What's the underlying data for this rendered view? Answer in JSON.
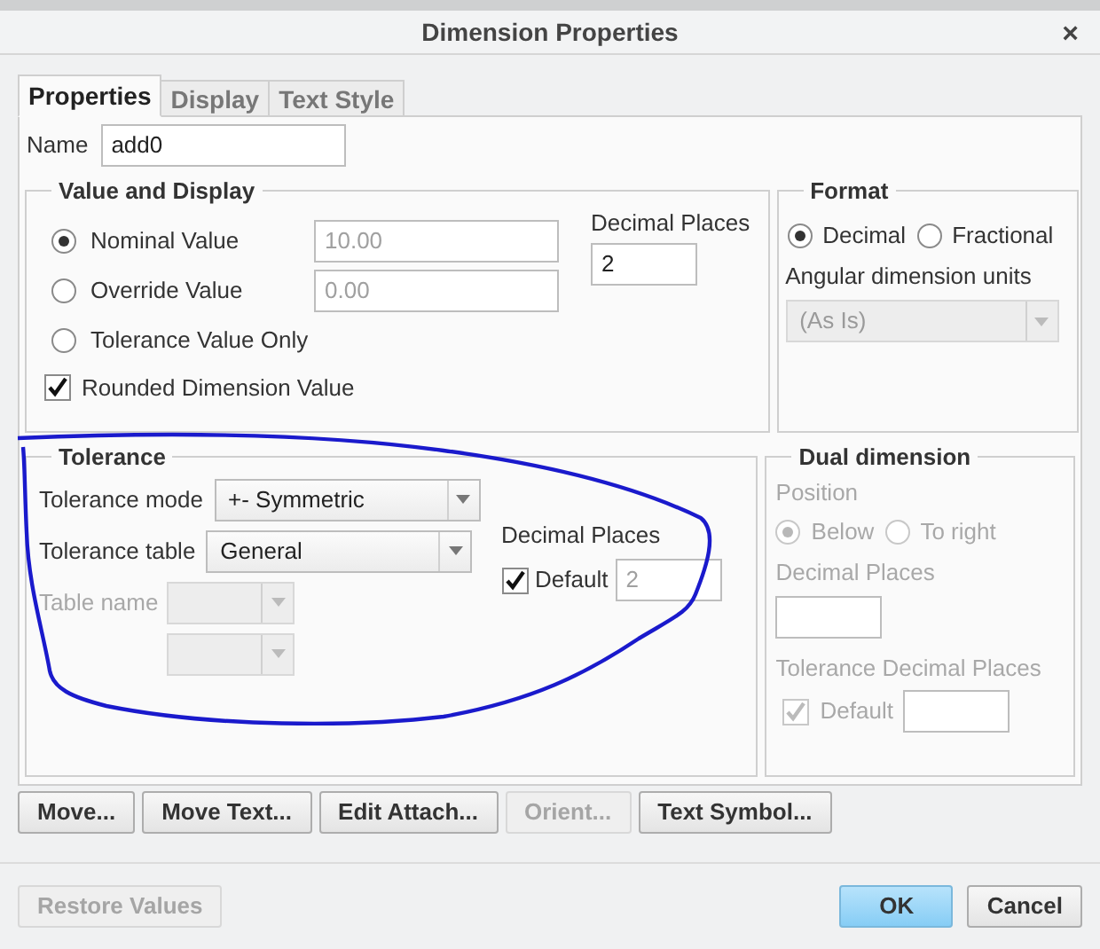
{
  "window": {
    "title": "Dimension Properties",
    "close": "×"
  },
  "tabs": [
    {
      "label": "Properties",
      "selected": true
    },
    {
      "label": "Display",
      "selected": false
    },
    {
      "label": "Text Style",
      "selected": false
    }
  ],
  "name": {
    "label": "Name",
    "value": "add0"
  },
  "value_and_display": {
    "title": "Value and Display",
    "options": [
      {
        "label": "Nominal Value",
        "selected": true,
        "field": {
          "value": "10.00",
          "disabled": true
        }
      },
      {
        "label": "Override Value",
        "selected": false,
        "field": {
          "value": "0.00",
          "disabled": true
        }
      },
      {
        "label": "Tolerance Value Only",
        "selected": false
      }
    ],
    "decimal_places": {
      "label": "Decimal Places",
      "value": "2"
    },
    "rounded": {
      "label": "Rounded Dimension Value",
      "checked": true
    }
  },
  "format": {
    "title": "Format",
    "options": [
      {
        "label": "Decimal",
        "selected": true
      },
      {
        "label": "Fractional",
        "selected": false
      }
    ],
    "angular_units": {
      "label": "Angular dimension units",
      "value": "(As Is)",
      "disabled": true
    }
  },
  "tolerance": {
    "title": "Tolerance",
    "mode": {
      "label": "Tolerance mode",
      "value": "+- Symmetric"
    },
    "table": {
      "label": "Tolerance table",
      "value": "General"
    },
    "table_name": {
      "label": "Table name",
      "disabled": true
    },
    "decimal_places": {
      "label": "Decimal Places",
      "default": {
        "label": "Default",
        "checked": true
      },
      "value": "2",
      "disabled": true
    }
  },
  "dual_dimension": {
    "title": "Dual dimension",
    "disabled": true,
    "position_label": "Position",
    "options": [
      {
        "label": "Below",
        "selected": true
      },
      {
        "label": "To right",
        "selected": false
      }
    ],
    "decimal_places_label": "Decimal Places",
    "tolerance_decimal_places_label": "Tolerance Decimal Places",
    "default": {
      "label": "Default",
      "checked": true
    }
  },
  "actions": [
    {
      "label": "Move...",
      "disabled": false
    },
    {
      "label": "Move Text...",
      "disabled": false
    },
    {
      "label": "Edit Attach...",
      "disabled": false
    },
    {
      "label": "Orient...",
      "disabled": true
    },
    {
      "label": "Text Symbol...",
      "disabled": false
    }
  ],
  "footer": [
    {
      "label": "Restore Values",
      "disabled": true,
      "kind": "secondary"
    },
    {
      "label": "OK",
      "disabled": false,
      "kind": "primary"
    },
    {
      "label": "Cancel",
      "disabled": false,
      "kind": "secondary"
    }
  ]
}
